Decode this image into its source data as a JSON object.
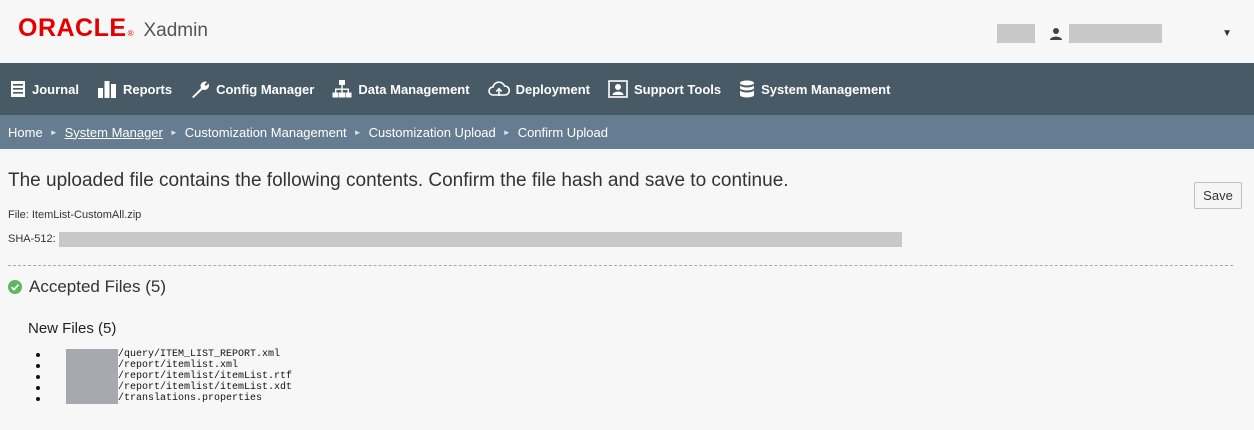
{
  "header": {
    "logo_text": "ORACLE",
    "logo_mark": "®",
    "app_name": "Xadmin",
    "user_icon": "user-icon",
    "user_menu_caret": "▼"
  },
  "nav": {
    "items": [
      {
        "label": "Journal",
        "icon": "journal-icon"
      },
      {
        "label": "Reports",
        "icon": "bar-chart-icon"
      },
      {
        "label": "Config Manager",
        "icon": "wrench-icon"
      },
      {
        "label": "Data Management",
        "icon": "hierarchy-icon"
      },
      {
        "label": "Deployment",
        "icon": "cloud-upload-icon"
      },
      {
        "label": "Support Tools",
        "icon": "support-person-icon"
      },
      {
        "label": "System Management",
        "icon": "database-icon"
      }
    ],
    "background": "#475a66"
  },
  "breadcrumb": {
    "items": [
      "Home",
      "System Manager",
      "Customization Management",
      "Customization Upload",
      "Confirm Upload"
    ],
    "separator": "►",
    "background": "#667d91"
  },
  "main": {
    "title": "The uploaded file contains the following contents. Confirm the file hash and save to continue.",
    "save_label": "Save",
    "file_label": "File: ItemList-CustomAll.zip",
    "hash_label": "SHA-512:",
    "accepted_heading": "Accepted Files (5)",
    "accepted_icon_color": "#5cb85c",
    "new_files_heading": "New Files (5)",
    "files": [
      "/query/ITEM_LIST_REPORT.xml",
      "/report/itemlist.xml",
      "/report/itemlist/itemList.rtf",
      "/report/itemlist/itemList.xdt",
      "/translations.properties"
    ]
  }
}
